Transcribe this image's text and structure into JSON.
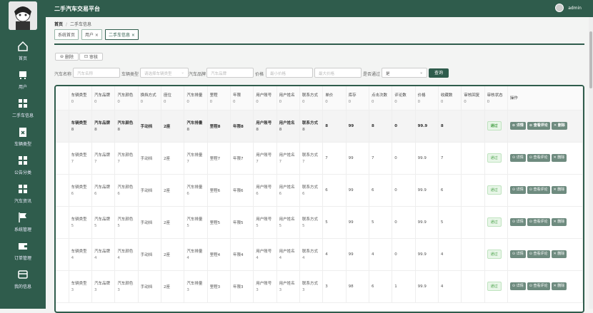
{
  "app": {
    "title": "二手汽车交易平台",
    "user": "admin"
  },
  "sidebar": {
    "items": [
      {
        "label": "首页",
        "icon": "home-icon"
      },
      {
        "label": "用户",
        "icon": "user-icon"
      },
      {
        "label": "二手车信息",
        "icon": "grid-icon"
      },
      {
        "label": "车辆类型",
        "icon": "clipboard-icon"
      },
      {
        "label": "公告分类",
        "icon": "grid-icon"
      },
      {
        "label": "汽车资讯",
        "icon": "grid-icon"
      },
      {
        "label": "系统管理",
        "icon": "flag-icon"
      },
      {
        "label": "订单管理",
        "icon": "wallet-icon"
      },
      {
        "label": "我的信息",
        "icon": "card-icon"
      }
    ]
  },
  "breadcrumb": {
    "home": "首页",
    "sep": "/",
    "current": "二手车信息"
  },
  "tabs": [
    {
      "label": "系统首页",
      "active": false
    },
    {
      "label": "用户 ×",
      "active": false
    },
    {
      "label": "二手车信息 ×",
      "active": true
    }
  ],
  "toolbar": {
    "delete": "删除",
    "review": "审核"
  },
  "filters": {
    "name_label": "汽车名称",
    "name_ph": "汽车名称",
    "type_label": "车辆类型",
    "type_ph": "请选择车辆类型",
    "brand_label": "汽车品牌",
    "brand_ph": "汽车品牌",
    "price_label": "价格",
    "min_ph": "最小价格",
    "max_ph": "最大价格",
    "pass_label": "是否通过",
    "pass_value": "是",
    "query": "查询"
  },
  "columns": [
    "车辆类型",
    "汽车品牌",
    "汽车颜色",
    "换挡方式",
    "座位",
    "汽车排量",
    "里程",
    "年限",
    "用户账号",
    "用户姓名",
    "联系方式",
    "单价",
    "库存",
    "点击次数",
    "评论数",
    "价格",
    "收藏数",
    "审核回复",
    "审核状态",
    "操作"
  ],
  "column_zero": "0",
  "rows": [
    {
      "n": "8",
      "shift": "手动挡",
      "seat": "2座",
      "mileage": "里程8",
      "year": "年限8",
      "price": "8",
      "stock": "99",
      "clicks": "8",
      "comments": "0",
      "p2": "99.9",
      "fav": "8",
      "status": "通过"
    },
    {
      "n": "7",
      "shift": "手动挡",
      "seat": "2座",
      "mileage": "里程7",
      "year": "年限7",
      "price": "7",
      "stock": "99",
      "clicks": "7",
      "comments": "0",
      "p2": "99.9",
      "fav": "7",
      "status": "通过"
    },
    {
      "n": "6",
      "shift": "手动挡",
      "seat": "2座",
      "mileage": "里程6",
      "year": "年限6",
      "price": "6",
      "stock": "99",
      "clicks": "6",
      "comments": "0",
      "p2": "99.9",
      "fav": "6",
      "status": "通过"
    },
    {
      "n": "5",
      "shift": "手动挡",
      "seat": "2座",
      "mileage": "里程5",
      "year": "年限5",
      "price": "5",
      "stock": "99",
      "clicks": "5",
      "comments": "0",
      "p2": "99.9",
      "fav": "5",
      "status": "通过"
    },
    {
      "n": "4",
      "shift": "手动挡",
      "seat": "2座",
      "mileage": "里程4",
      "year": "年限4",
      "price": "4",
      "stock": "99",
      "clicks": "4",
      "comments": "0",
      "p2": "99.9",
      "fav": "4",
      "status": "通过"
    },
    {
      "n": "3",
      "shift": "手动挡",
      "seat": "2座",
      "mileage": "里程3",
      "year": "年限3",
      "price": "3",
      "stock": "98",
      "clicks": "6",
      "comments": "1",
      "p2": "99.9",
      "fav": "4",
      "status": "通过"
    }
  ],
  "actions": {
    "detail": "详情",
    "comments": "查看评论",
    "delete": "删除"
  }
}
